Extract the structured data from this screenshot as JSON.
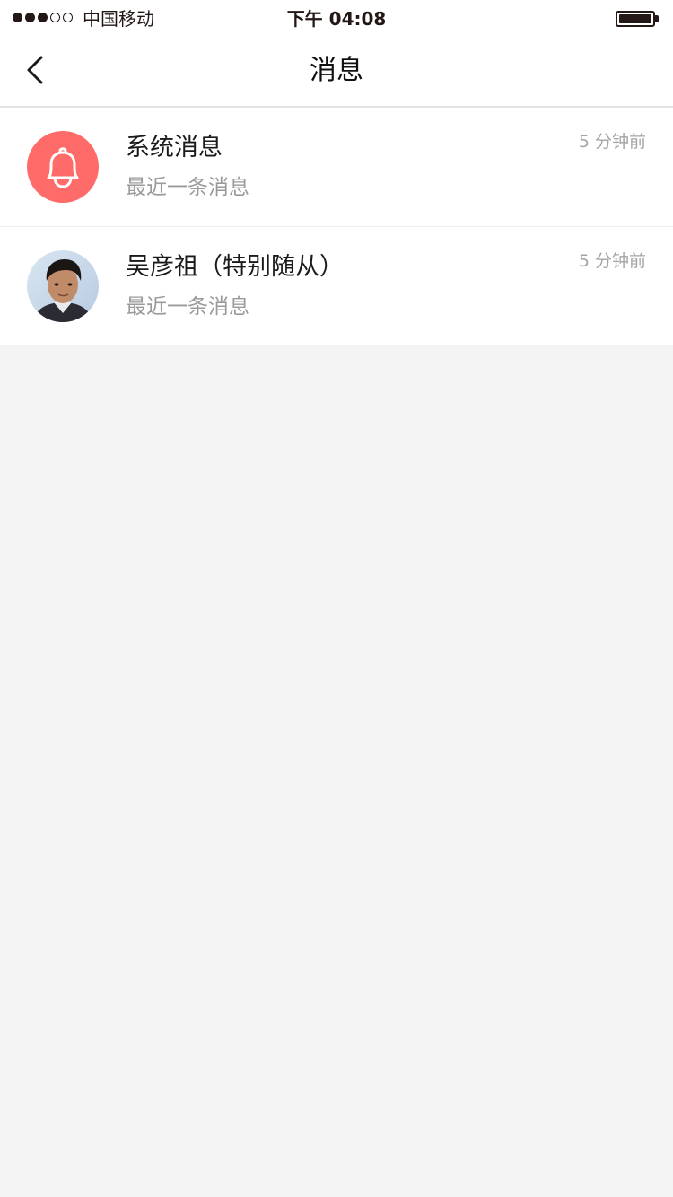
{
  "status_bar": {
    "carrier": "中国移动",
    "time": "下午 04:08",
    "signal_strength": 3,
    "signal_max": 5,
    "battery_level": 1.0
  },
  "nav": {
    "title": "消息",
    "back_icon": "chevron-left-icon"
  },
  "messages": [
    {
      "name": "系统消息",
      "preview": "最近一条消息",
      "time": "5 分钟前",
      "avatar_icon": "bell-icon",
      "avatar_color": "#ff6b68"
    },
    {
      "name": "吴彦祖（特别随从）",
      "preview": "最近一条消息",
      "time": "5 分钟前",
      "avatar_icon": "user-photo"
    }
  ],
  "colors": {
    "background": "#f4f4f4",
    "accent": "#ff6b68",
    "text_primary": "#1a1a1a",
    "text_secondary": "#9a9a9a"
  }
}
